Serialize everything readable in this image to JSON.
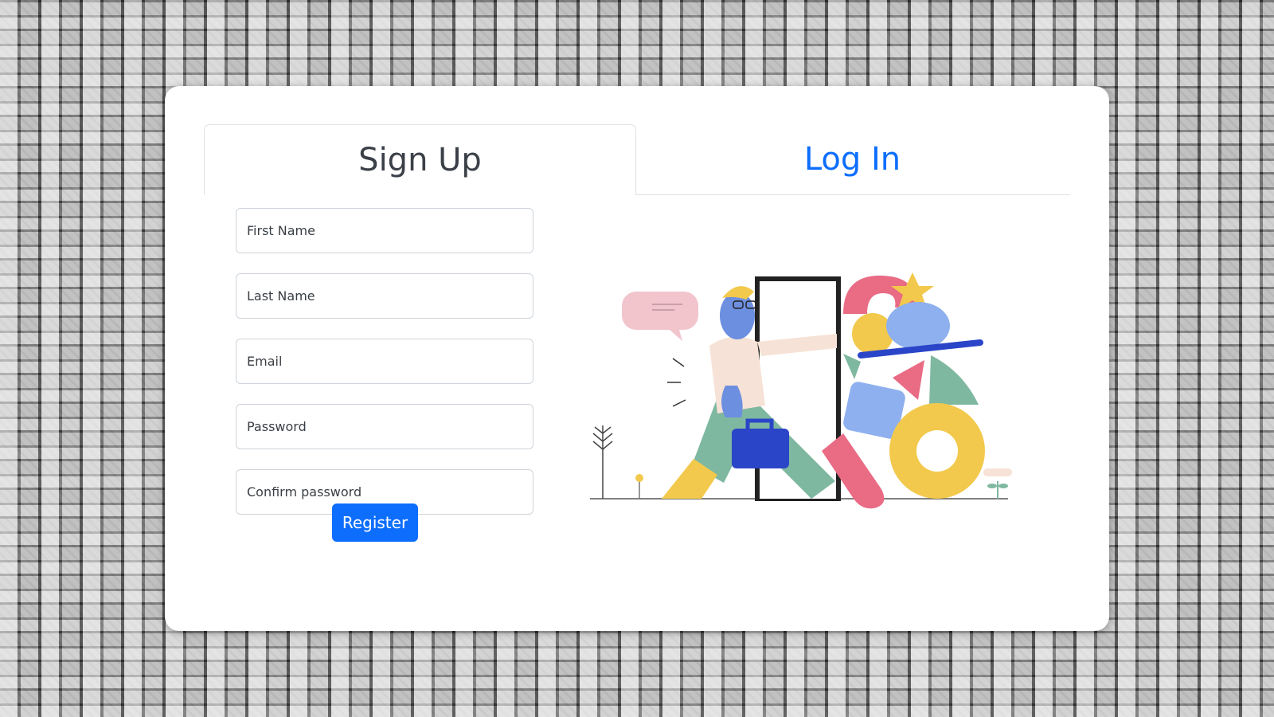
{
  "tabs": {
    "signup": "Sign Up",
    "login": "Log In"
  },
  "form": {
    "first_name_placeholder": "First Name",
    "last_name_placeholder": "Last Name",
    "email_placeholder": "Email",
    "password_placeholder": "Password",
    "confirm_password_placeholder": "Confirm password",
    "register_label": "Register"
  },
  "colors": {
    "accent": "#0d6efd",
    "card": "#ffffff"
  },
  "icons": {
    "illustration": "person-walking-through-door-with-briefcase-and-shapes"
  }
}
